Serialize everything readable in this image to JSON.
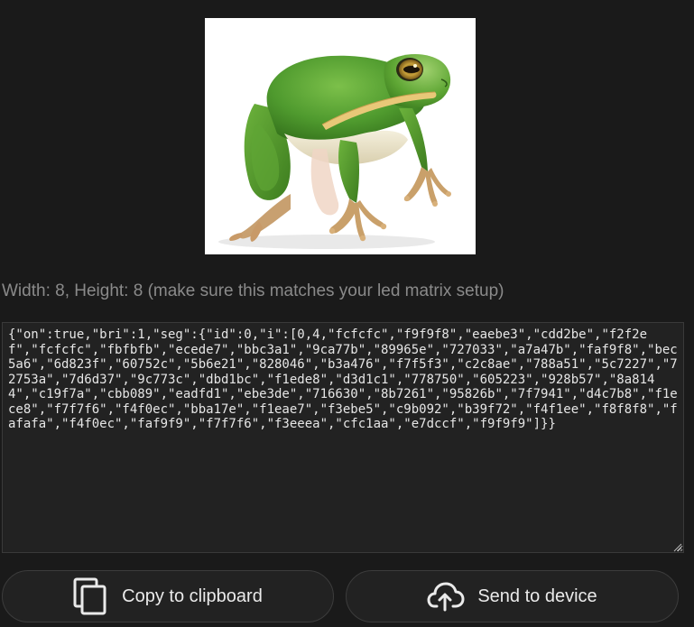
{
  "preview": {
    "subject": "green tree frog",
    "background_color": "#ffffff"
  },
  "dimensions_text": "Width: 8, Height: 8 (make sure this matches your led matrix setup)",
  "json_output": "{\"on\":true,\"bri\":1,\"seg\":{\"id\":0,\"i\":[0,4,\"fcfcfc\",\"f9f9f8\",\"eaebe3\",\"cdd2be\",\"f2f2ef\",\"fcfcfc\",\"fbfbfb\",\"ecede7\",\"bbc3a1\",\"9ca77b\",\"89965e\",\"727033\",\"a7a47b\",\"faf9f8\",\"bec5a6\",\"6d823f\",\"60752c\",\"5b6e21\",\"828046\",\"b3a476\",\"f7f5f3\",\"c2c8ae\",\"788a51\",\"5c7227\",\"72753a\",\"7d6d37\",\"9c773c\",\"dbd1bc\",\"f1ede8\",\"d3d1c1\",\"778750\",\"605223\",\"928b57\",\"8a8144\",\"c19f7a\",\"cbb089\",\"eadfd1\",\"ebe3de\",\"716630\",\"8b7261\",\"95826b\",\"7f7941\",\"d4c7b8\",\"f1ece8\",\"f7f7f6\",\"f4f0ec\",\"bba17e\",\"f1eae7\",\"f3ebe5\",\"c9b092\",\"b39f72\",\"f4f1ee\",\"f8f8f8\",\"fafafa\",\"f4f0ec\",\"faf9f9\",\"f7f7f6\",\"f3eeea\",\"cfc1aa\",\"e7dccf\",\"f9f9f9\"]}}",
  "buttons": {
    "copy_label": "Copy to clipboard",
    "copy_icon": "copy-icon",
    "send_label": "Send to device",
    "send_icon": "cloud-upload-icon"
  },
  "colors": {
    "page_background": "#1a1a1a",
    "textarea_background": "#222222",
    "button_background": "#222222",
    "muted_text": "#8a8a8a",
    "frog_green": "#4f9a2e",
    "frog_belly": "#f1ead0",
    "frog_stripe": "#e8c878"
  }
}
